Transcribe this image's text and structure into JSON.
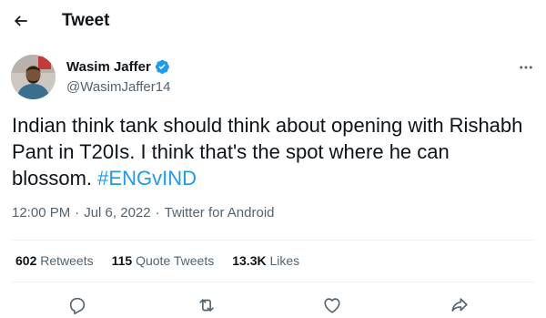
{
  "header": {
    "title": "Tweet",
    "back_icon": "arrow-left-icon"
  },
  "author": {
    "display_name": "Wasim Jaffer",
    "handle": "@WasimJaffer14",
    "verified_icon": "verified-badge-icon",
    "more_icon": "more-horizontal-icon"
  },
  "tweet": {
    "text": "Indian think tank should think about opening with Rishabh Pant in T20Is. I think that's the spot where he can blossom.",
    "hashtag": "#ENGvIND"
  },
  "meta": {
    "time": "12:00 PM",
    "date": "Jul 6, 2022",
    "separator": "·",
    "source": "Twitter for Android"
  },
  "stats": {
    "retweets_count": "602",
    "retweets_label": "Retweets",
    "quotes_count": "115",
    "quotes_label": "Quote Tweets",
    "likes_count": "13.3K",
    "likes_label": "Likes"
  },
  "actions": [
    "reply-icon",
    "retweet-icon",
    "like-icon",
    "share-icon"
  ],
  "colors": {
    "link": "#1d9bf0",
    "secondary_text": "#536471",
    "primary_text": "#0f1419",
    "divider": "#eff3f4"
  }
}
